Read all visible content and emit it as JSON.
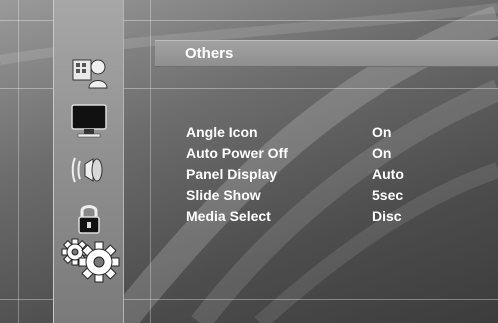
{
  "sidebar": {
    "items": [
      {
        "icon": "language-icon"
      },
      {
        "icon": "display-icon"
      },
      {
        "icon": "audio-icon"
      },
      {
        "icon": "lock-icon"
      },
      {
        "icon": "gears-icon"
      }
    ]
  },
  "header": {
    "title": "Others"
  },
  "settings": [
    {
      "label": "Angle Icon",
      "value": "On"
    },
    {
      "label": "Auto Power Off",
      "value": "On"
    },
    {
      "label": "Panel Display",
      "value": "Auto"
    },
    {
      "label": "Slide Show",
      "value": "5sec"
    },
    {
      "label": "Media Select",
      "value": "Disc"
    }
  ]
}
